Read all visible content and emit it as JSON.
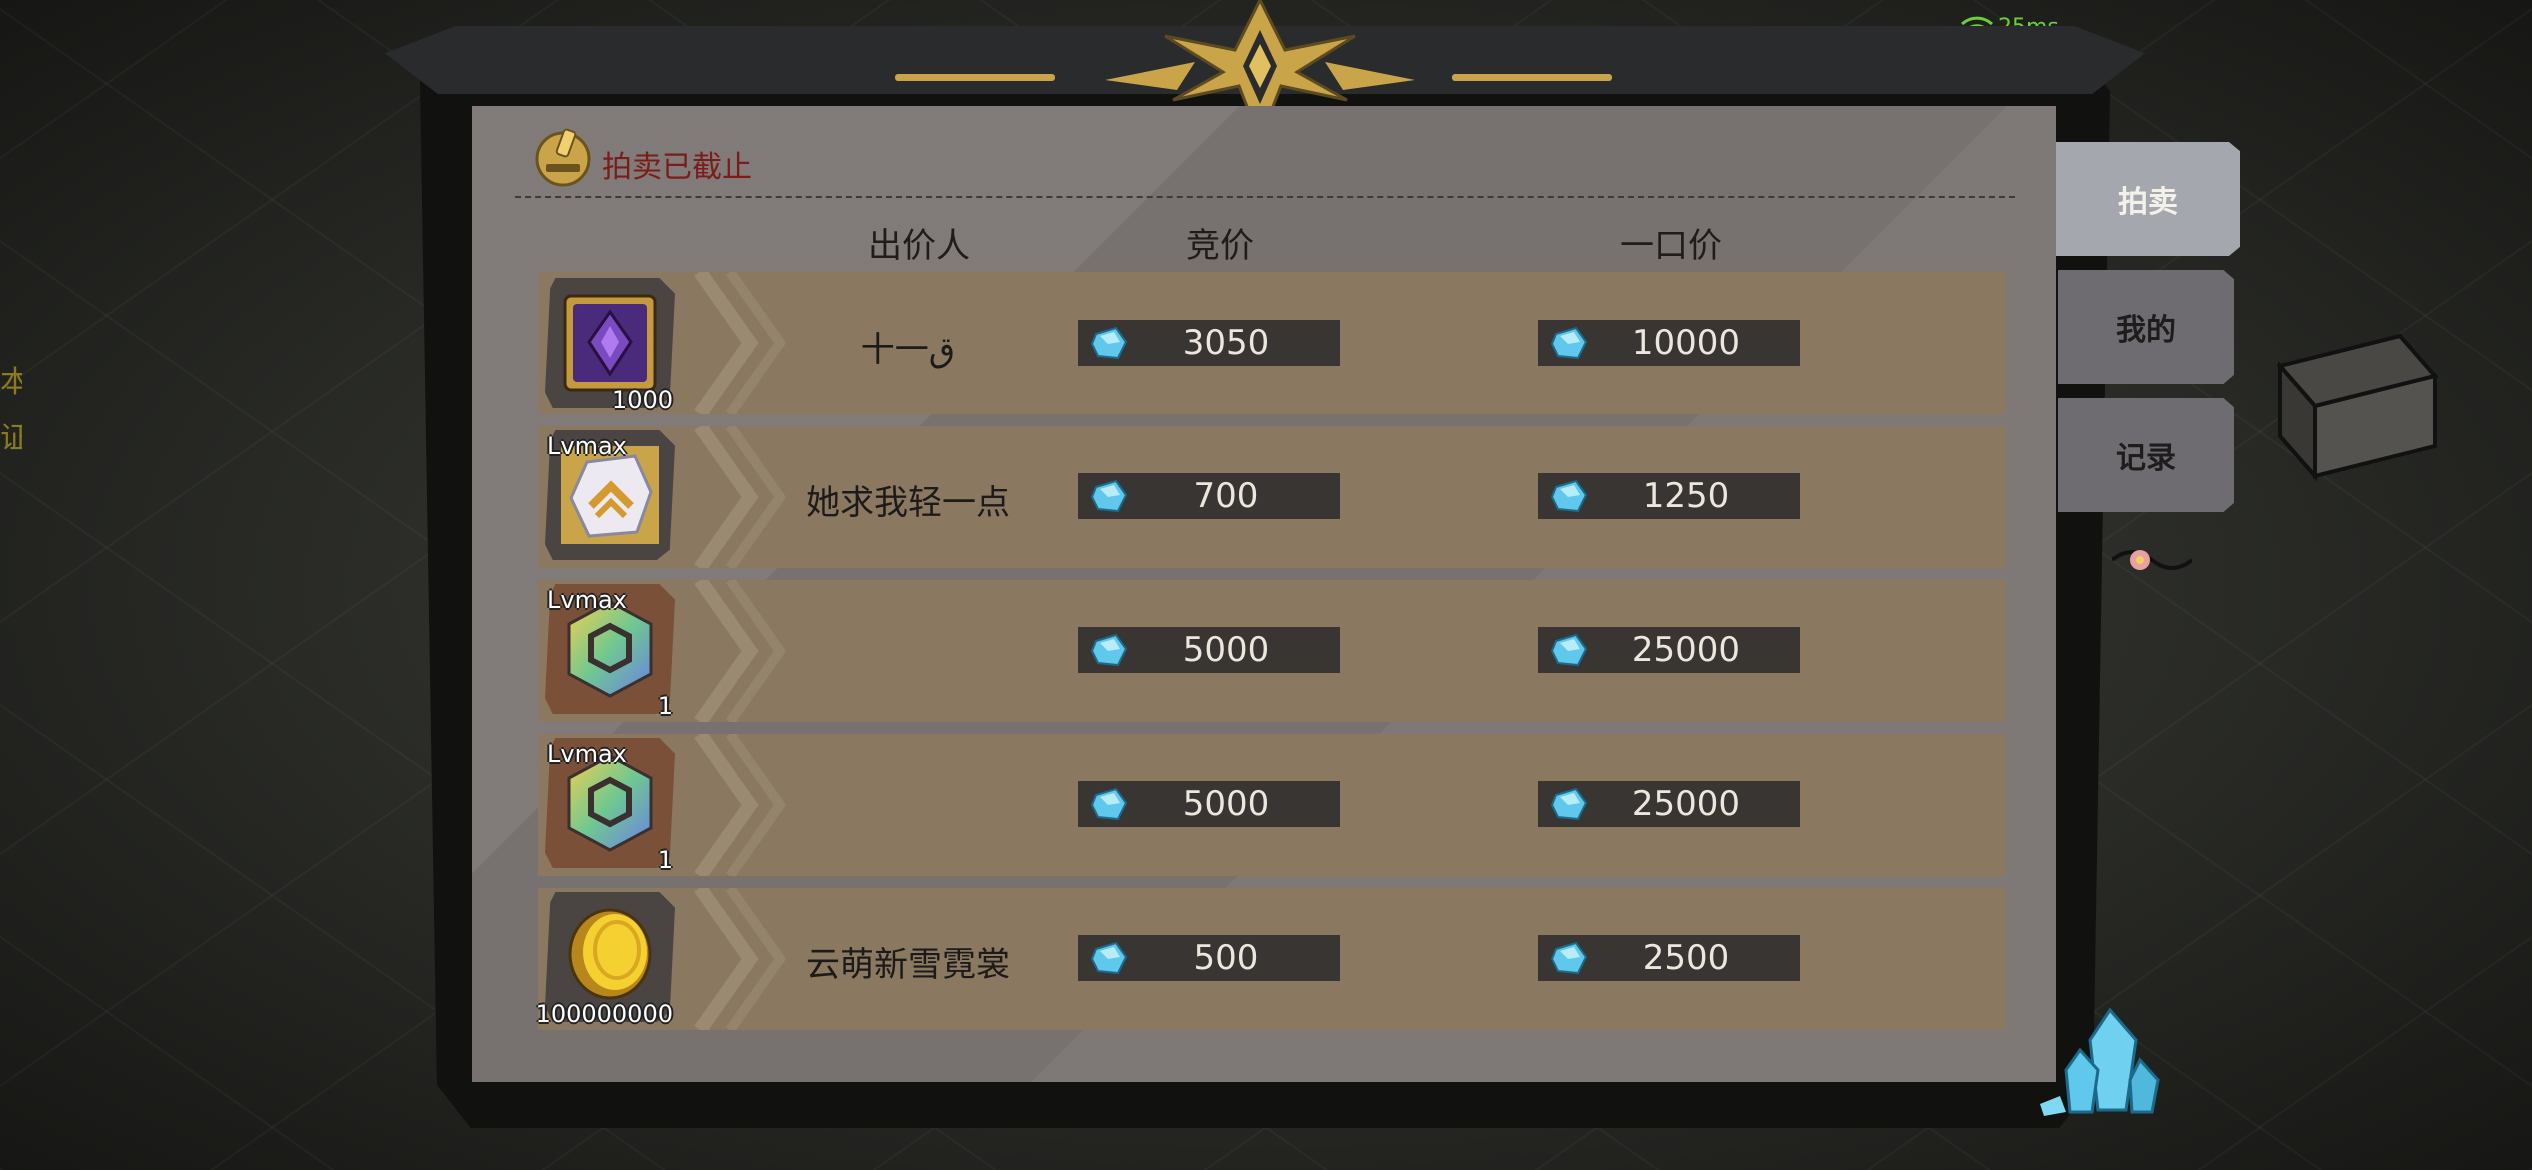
{
  "status": {
    "ping": "25ms",
    "auction_state": "拍卖已截止"
  },
  "columns": {
    "bidder": "出价人",
    "bid": "竞价",
    "buyout": "一口价"
  },
  "listings": [
    {
      "item_icon": "purple-rune-book-icon",
      "item_qty": "1000",
      "item_level": "",
      "bidder": "十一ق",
      "bid": "3050",
      "buyout": "10000"
    },
    {
      "item_icon": "white-rank-crystal-icon",
      "item_qty": "",
      "item_level": "Lvmax",
      "bidder": "她求我轻一点",
      "bid": "700",
      "buyout": "1250"
    },
    {
      "item_icon": "rainbow-gem-icon",
      "item_qty": "1",
      "item_level": "Lvmax",
      "bidder": "",
      "bid": "5000",
      "buyout": "25000"
    },
    {
      "item_icon": "rainbow-gem-icon",
      "item_qty": "1",
      "item_level": "Lvmax",
      "bidder": "",
      "bid": "5000",
      "buyout": "25000"
    },
    {
      "item_icon": "gold-coin-icon",
      "item_qty": "100000000",
      "item_level": "",
      "bidder": "云萌新雪霓裳",
      "bid": "500",
      "buyout": "2500"
    }
  ],
  "tabs": [
    {
      "label": "拍卖",
      "active": true
    },
    {
      "label": "我的",
      "active": false
    },
    {
      "label": "记录",
      "active": false
    }
  ],
  "bg_side_text": "本\n证",
  "colors": {
    "row_bg": "#8a7860",
    "panel_bg": "#77716f",
    "status_red": "#7a1d1a",
    "gem_blue": "#5fc8ec",
    "gold": "#c9a449"
  }
}
